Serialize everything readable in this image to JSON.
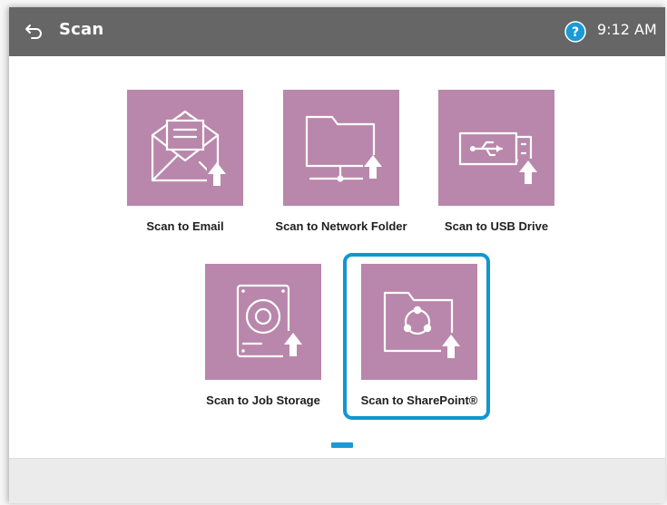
{
  "header": {
    "title": "Scan",
    "time": "9:12 AM",
    "back_icon": "back-arrow-icon",
    "help_icon": "help-icon"
  },
  "tiles": [
    {
      "label": "Scan to Email",
      "icon": "email-upload-icon"
    },
    {
      "label": "Scan to Network Folder",
      "icon": "network-folder-upload-icon"
    },
    {
      "label": "Scan to USB Drive",
      "icon": "usb-upload-icon"
    },
    {
      "label": "Scan to Job Storage",
      "icon": "job-storage-upload-icon"
    },
    {
      "label": "Scan to SharePoint®",
      "icon": "sharepoint-upload-icon",
      "selected": true
    }
  ],
  "pager": {
    "current_page": 1,
    "total_pages": 1
  },
  "colors": {
    "header_bg": "#666666",
    "tile_bg": "#b987ab",
    "selection_border": "#0f97d1",
    "pager_active": "#1a9ad6"
  }
}
